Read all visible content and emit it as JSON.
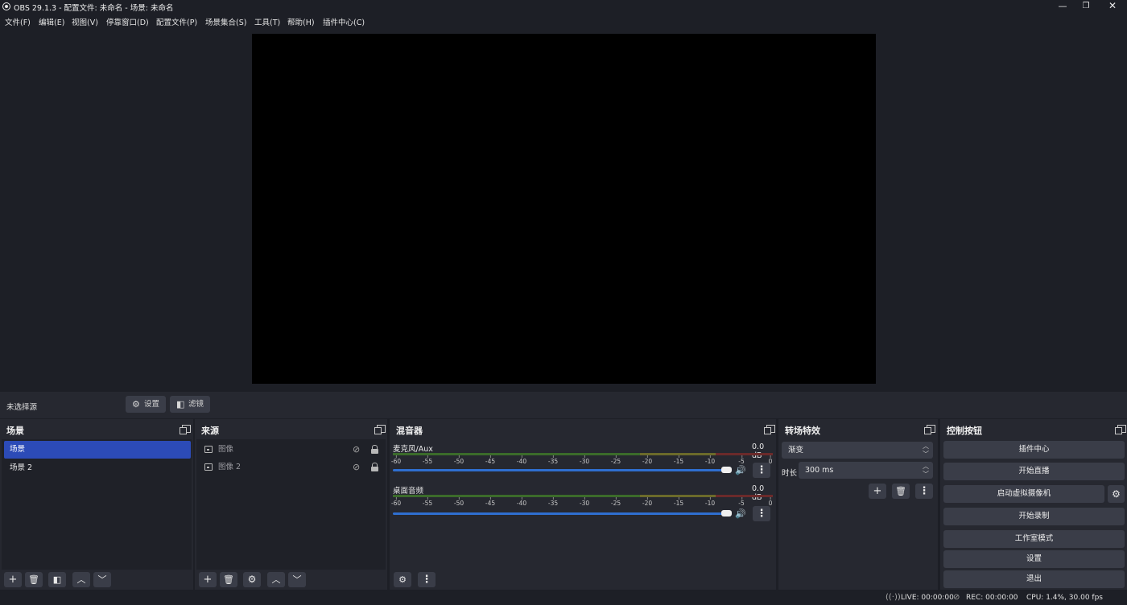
{
  "window": {
    "title": "OBS 29.1.3 - 配置文件: 未命名 - 场景: 未命名",
    "min_glyph": "—",
    "restore_glyph": "❐",
    "close_glyph": "✕"
  },
  "menubar": {
    "items": [
      "文件(F)",
      "编辑(E)",
      "视图(V)",
      "停靠窗口(D)",
      "配置文件(P)",
      "场景集合(S)",
      "工具(T)",
      "帮助(H)",
      "插件中心(C)"
    ]
  },
  "context_bar": {
    "no_source": "未选择源",
    "settings_label": "设置",
    "filters_label": "滤镜"
  },
  "scenes": {
    "title": "场景",
    "items": [
      {
        "label": "场景",
        "active": true
      },
      {
        "label": "场景 2",
        "active": false
      }
    ]
  },
  "sources": {
    "title": "来源",
    "items": [
      {
        "label": "图像"
      },
      {
        "label": "图像 2"
      }
    ]
  },
  "mixer": {
    "title": "混音器",
    "tick_labels": [
      "-60",
      "-55",
      "-50",
      "-45",
      "-40",
      "-35",
      "-30",
      "-25",
      "-20",
      "-15",
      "-10",
      "-5",
      "0"
    ],
    "tracks": [
      {
        "name": "麦克风/Aux",
        "db": "0.0 dB",
        "volume_percent": 100
      },
      {
        "name": "桌面音频",
        "db": "0.0 dB",
        "volume_percent": 100
      }
    ]
  },
  "transitions": {
    "title": "转场特效",
    "selected": "渐变",
    "duration_label": "时长",
    "duration_value": "300 ms"
  },
  "controls": {
    "title": "控制按钮",
    "plugin_center": "插件中心",
    "start_streaming": "开始直播",
    "start_virtual_cam": "启动虚拟摄像机",
    "start_recording": "开始录制",
    "studio_mode": "工作室模式",
    "settings": "设置",
    "exit": "退出"
  },
  "statusbar": {
    "live": "LIVE: 00:00:00",
    "rec": "REC: 00:00:00",
    "cpu": "CPU: 1.4%, 30.00 fps"
  },
  "icons": {
    "add": "+",
    "remove": "🗑",
    "up": "︿",
    "down": "﹀",
    "gear": "⚙",
    "more": "⋮",
    "volume": "🔊",
    "eye_off": "◉"
  }
}
